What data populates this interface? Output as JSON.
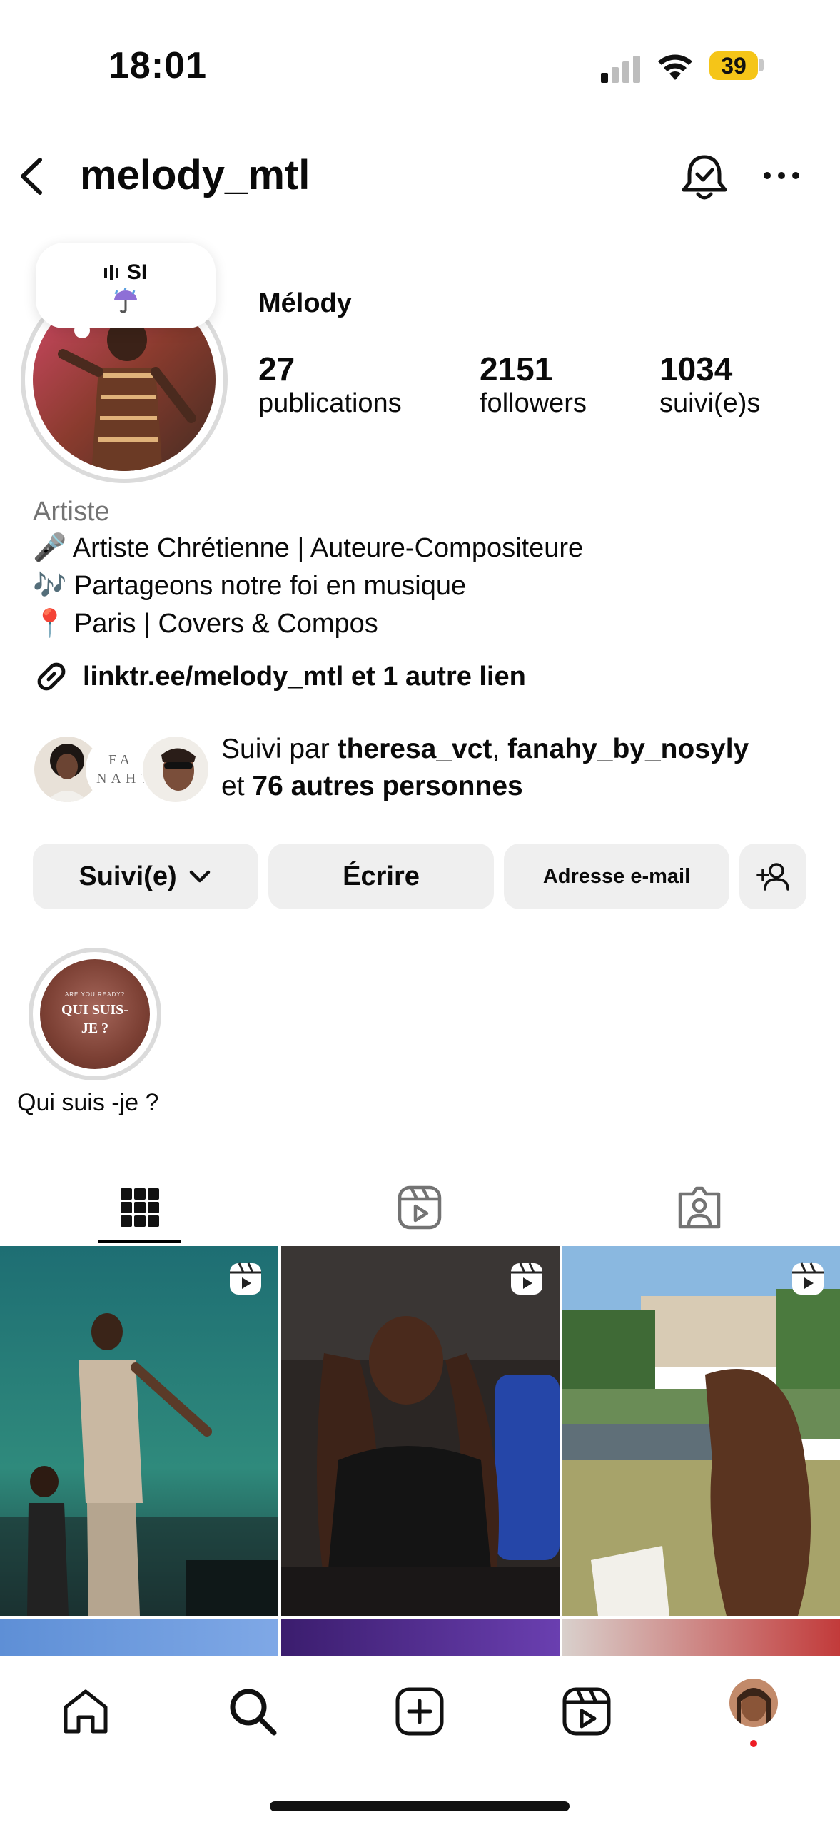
{
  "status_bar": {
    "time": "18:01",
    "battery": "39"
  },
  "header": {
    "username": "melody_mtl"
  },
  "note": {
    "text": "SI"
  },
  "profile": {
    "display_name": "Mélody",
    "stats": [
      {
        "value": "27",
        "label": "publications"
      },
      {
        "value": "2151",
        "label": "followers"
      },
      {
        "value": "1034",
        "label": "suivi(e)s"
      }
    ],
    "category": "Artiste",
    "bio": [
      {
        "emoji": "🎤",
        "text": "Artiste Chrétienne | Auteure-Compositeure"
      },
      {
        "emoji": "🎶",
        "text": "Partageons notre foi en musique"
      },
      {
        "emoji": "📍",
        "text": "Paris | Covers & Compos"
      }
    ],
    "link": "linktr.ee/melody_mtl et 1 autre lien",
    "followed_by": {
      "prefix": "Suivi par",
      "user1": "theresa_vct",
      "sep": ",",
      "user2": "fanahy_by_nosyly",
      "and": "et",
      "others": "76 autres personnes",
      "avatar2_text": "FA NAHY"
    }
  },
  "buttons": {
    "following": "Suivi(e)",
    "message": "Écrire",
    "email": "Adresse e-mail"
  },
  "highlight": {
    "label": "Qui suis -je ?",
    "cover_small": "ARE YOU READY?",
    "cover_main": "QUI SUIS-JE ?"
  },
  "colors": {
    "battery": "#f5c518",
    "button_bg": "#efefef",
    "notification_dot": "#ed1c24"
  }
}
